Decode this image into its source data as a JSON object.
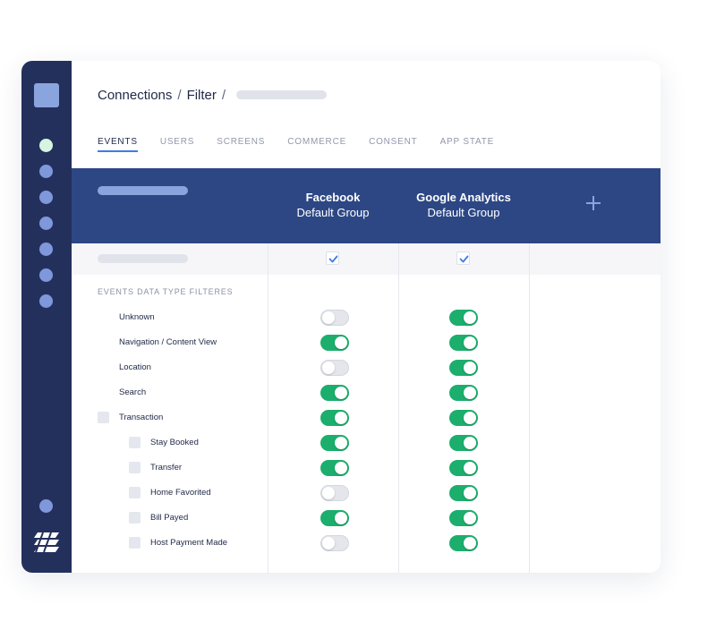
{
  "breadcrumb": {
    "items": [
      "Connections",
      "Filter"
    ],
    "separator": "/"
  },
  "tabs": [
    {
      "label": "EVENTS",
      "active": true
    },
    {
      "label": "USERS",
      "active": false
    },
    {
      "label": "SCREENS",
      "active": false
    },
    {
      "label": "COMMERCE",
      "active": false
    },
    {
      "label": "CONSENT",
      "active": false
    },
    {
      "label": "APP STATE",
      "active": false
    }
  ],
  "columns": [
    {
      "name": "Facebook",
      "group": "Default Group",
      "all_checked": true
    },
    {
      "name": "Google Analytics",
      "group": "Default Group",
      "all_checked": true
    }
  ],
  "add_column_icon": "plus-icon",
  "section_label": "EVENTS DATA TYPE FILTERES",
  "rows": [
    {
      "label": "Unknown",
      "level": 0,
      "checkbox": false,
      "facebook": false,
      "google_analytics": true
    },
    {
      "label": "Navigation / Content View",
      "level": 0,
      "checkbox": false,
      "facebook": true,
      "google_analytics": true
    },
    {
      "label": "Location",
      "level": 0,
      "checkbox": false,
      "facebook": false,
      "google_analytics": true
    },
    {
      "label": "Search",
      "level": 0,
      "checkbox": false,
      "facebook": true,
      "google_analytics": true
    },
    {
      "label": "Transaction",
      "level": 0,
      "checkbox": true,
      "facebook": true,
      "google_analytics": true
    },
    {
      "label": "Stay Booked",
      "level": 1,
      "checkbox": true,
      "facebook": true,
      "google_analytics": true
    },
    {
      "label": "Transfer",
      "level": 1,
      "checkbox": true,
      "facebook": true,
      "google_analytics": true
    },
    {
      "label": "Home Favorited",
      "level": 1,
      "checkbox": true,
      "facebook": false,
      "google_analytics": true
    },
    {
      "label": "Bill Payed",
      "level": 1,
      "checkbox": true,
      "facebook": true,
      "google_analytics": true
    },
    {
      "label": "Host Payment Made",
      "level": 1,
      "checkbox": true,
      "facebook": false,
      "google_analytics": true
    }
  ],
  "colors": {
    "sidebar": "#24305c",
    "header": "#2d4785",
    "toggle_on": "#1cae6c",
    "accent": "#3f7be8"
  }
}
